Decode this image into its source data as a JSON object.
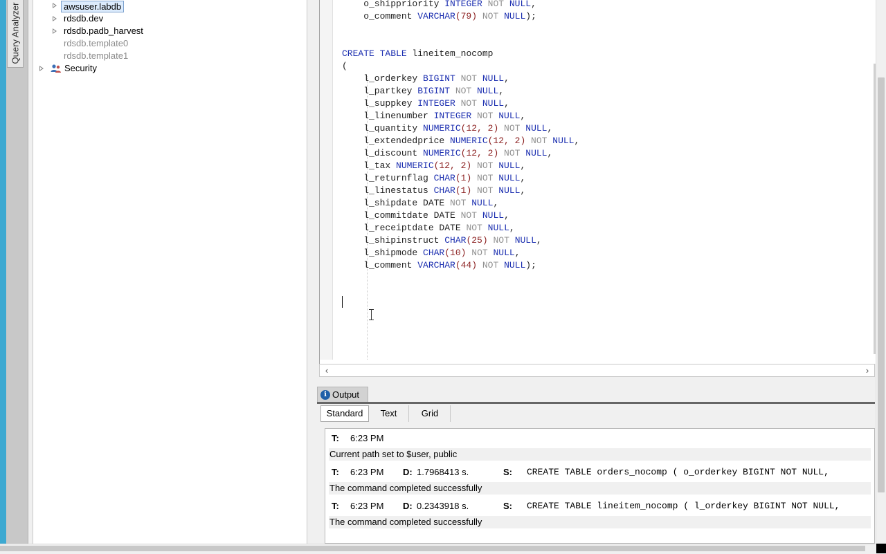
{
  "sidebar_tab": {
    "label": "Query Analyzer"
  },
  "tree": {
    "items": [
      {
        "label": "awsuser.labdb",
        "selected": true
      },
      {
        "label": "rdsdb.dev"
      },
      {
        "label": "rdsdb.padb_harvest"
      },
      {
        "label": "rdsdb.template0",
        "disabled": true
      },
      {
        "label": "rdsdb.template1",
        "disabled": true
      },
      {
        "label": "Security",
        "icon": "users-icon"
      }
    ]
  },
  "editor": {
    "lines": [
      [
        [
          "    o_shippriority ",
          ""
        ],
        [
          "INTEGER",
          "kw"
        ],
        [
          " NOT",
          "gr"
        ],
        [
          " NULL",
          "kw"
        ],
        [
          ",",
          ""
        ]
      ],
      [
        [
          "    o_comment ",
          ""
        ],
        [
          "VARCHAR",
          "kw"
        ],
        [
          "(79)",
          "num"
        ],
        [
          " NOT",
          "gr"
        ],
        [
          " NULL",
          "kw"
        ],
        [
          ");",
          ""
        ]
      ],
      [],
      [],
      [
        [
          "CREATE TABLE",
          "kw"
        ],
        [
          " lineitem_nocomp",
          ""
        ]
      ],
      [
        [
          "(",
          ""
        ]
      ],
      [
        [
          "    l_orderkey ",
          ""
        ],
        [
          "BIGINT",
          "kw"
        ],
        [
          " NOT",
          "gr"
        ],
        [
          " NULL",
          "kw"
        ],
        [
          ",",
          ""
        ]
      ],
      [
        [
          "    l_partkey ",
          ""
        ],
        [
          "BIGINT",
          "kw"
        ],
        [
          " NOT",
          "gr"
        ],
        [
          " NULL",
          "kw"
        ],
        [
          ",",
          ""
        ]
      ],
      [
        [
          "    l_suppkey ",
          ""
        ],
        [
          "INTEGER",
          "kw"
        ],
        [
          " NOT",
          "gr"
        ],
        [
          " NULL",
          "kw"
        ],
        [
          ",",
          ""
        ]
      ],
      [
        [
          "    l_linenumber ",
          ""
        ],
        [
          "INTEGER",
          "kw"
        ],
        [
          " NOT",
          "gr"
        ],
        [
          " NULL",
          "kw"
        ],
        [
          ",",
          ""
        ]
      ],
      [
        [
          "    l_quantity ",
          ""
        ],
        [
          "NUMERIC",
          "kw"
        ],
        [
          "(12, 2)",
          "num"
        ],
        [
          " NOT",
          "gr"
        ],
        [
          " NULL",
          "kw"
        ],
        [
          ",",
          ""
        ]
      ],
      [
        [
          "    l_extendedprice ",
          ""
        ],
        [
          "NUMERIC",
          "kw"
        ],
        [
          "(12, 2)",
          "num"
        ],
        [
          " NOT",
          "gr"
        ],
        [
          " NULL",
          "kw"
        ],
        [
          ",",
          ""
        ]
      ],
      [
        [
          "    l_discount ",
          ""
        ],
        [
          "NUMERIC",
          "kw"
        ],
        [
          "(12, 2)",
          "num"
        ],
        [
          " NOT",
          "gr"
        ],
        [
          " NULL",
          "kw"
        ],
        [
          ",",
          ""
        ]
      ],
      [
        [
          "    l_tax ",
          ""
        ],
        [
          "NUMERIC",
          "kw"
        ],
        [
          "(12, 2)",
          "num"
        ],
        [
          " NOT",
          "gr"
        ],
        [
          " NULL",
          "kw"
        ],
        [
          ",",
          ""
        ]
      ],
      [
        [
          "    l_returnflag ",
          ""
        ],
        [
          "CHAR",
          "kw"
        ],
        [
          "(1)",
          "num"
        ],
        [
          " NOT",
          "gr"
        ],
        [
          " NULL",
          "kw"
        ],
        [
          ",",
          ""
        ]
      ],
      [
        [
          "    l_linestatus ",
          ""
        ],
        [
          "CHAR",
          "kw"
        ],
        [
          "(1)",
          "num"
        ],
        [
          " NOT",
          "gr"
        ],
        [
          " NULL",
          "kw"
        ],
        [
          ",",
          ""
        ]
      ],
      [
        [
          "    l_shipdate DATE",
          ""
        ],
        [
          " NOT",
          "gr"
        ],
        [
          " NULL",
          "kw"
        ],
        [
          ",",
          ""
        ]
      ],
      [
        [
          "    l_commitdate DATE",
          ""
        ],
        [
          " NOT",
          "gr"
        ],
        [
          " NULL",
          "kw"
        ],
        [
          ",",
          ""
        ]
      ],
      [
        [
          "    l_receiptdate DATE",
          ""
        ],
        [
          " NOT",
          "gr"
        ],
        [
          " NULL",
          "kw"
        ],
        [
          ",",
          ""
        ]
      ],
      [
        [
          "    l_shipinstruct ",
          ""
        ],
        [
          "CHAR",
          "kw"
        ],
        [
          "(25)",
          "num"
        ],
        [
          " NOT",
          "gr"
        ],
        [
          " NULL",
          "kw"
        ],
        [
          ",",
          ""
        ]
      ],
      [
        [
          "    l_shipmode ",
          ""
        ],
        [
          "CHAR",
          "kw"
        ],
        [
          "(10)",
          "num"
        ],
        [
          " NOT",
          "gr"
        ],
        [
          " NULL",
          "kw"
        ],
        [
          ",",
          ""
        ]
      ],
      [
        [
          "    l_comment ",
          ""
        ],
        [
          "VARCHAR",
          "kw"
        ],
        [
          "(44)",
          "num"
        ],
        [
          " NOT",
          "gr"
        ],
        [
          " NULL",
          "kw"
        ],
        [
          ");",
          ""
        ]
      ]
    ]
  },
  "output": {
    "tab_label": "Output",
    "subtabs": [
      "Standard",
      "Text",
      "Grid"
    ],
    "labels": {
      "time": "T:",
      "duration": "D:",
      "statement": "S:"
    },
    "entries": [
      {
        "time": "6:23 PM",
        "message": "Current path set to $user, public"
      },
      {
        "time": "6:23 PM",
        "duration": "1.7968413 s.",
        "statement": "CREATE TABLE orders_nocomp (  o_orderkey BIGINT NOT NULL,",
        "message": "The command completed successfully"
      },
      {
        "time": "6:23 PM",
        "duration": "0.2343918 s.",
        "statement": "CREATE TABLE lineitem_nocomp (  l_orderkey BIGINT NOT NULL,",
        "message": "The command completed successfully"
      }
    ]
  }
}
